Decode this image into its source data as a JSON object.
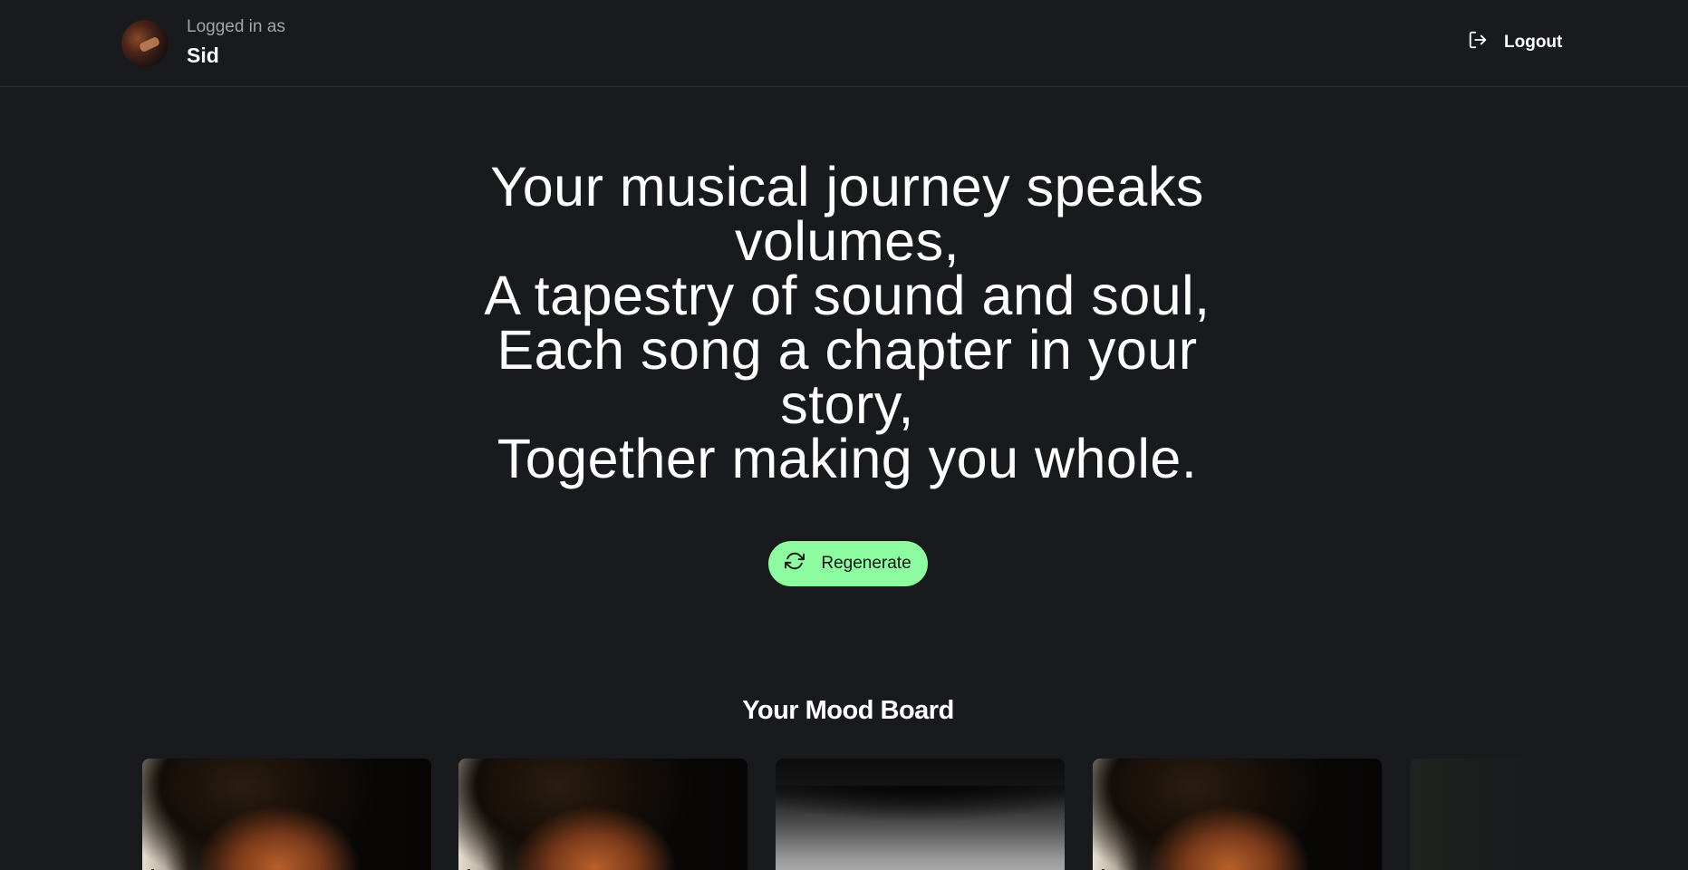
{
  "header": {
    "logged_label": "Logged in as",
    "user_name": "Sid",
    "logout_label": "Logout"
  },
  "poem": {
    "lines": [
      "Your musical journey speaks volumes,",
      "A tapestry of sound and soul,",
      "Each song a chapter in your story,",
      "Together making you whole."
    ]
  },
  "regenerate_label": "Regenerate",
  "mood_board": {
    "title": "Your Mood Board"
  },
  "colors": {
    "background": "#191a1e",
    "accent": "#8dfca0",
    "text": "#ffffff",
    "muted_text": "#a3a4a8"
  },
  "icons": {
    "logout": "logout-icon",
    "regenerate": "refresh-icon"
  }
}
